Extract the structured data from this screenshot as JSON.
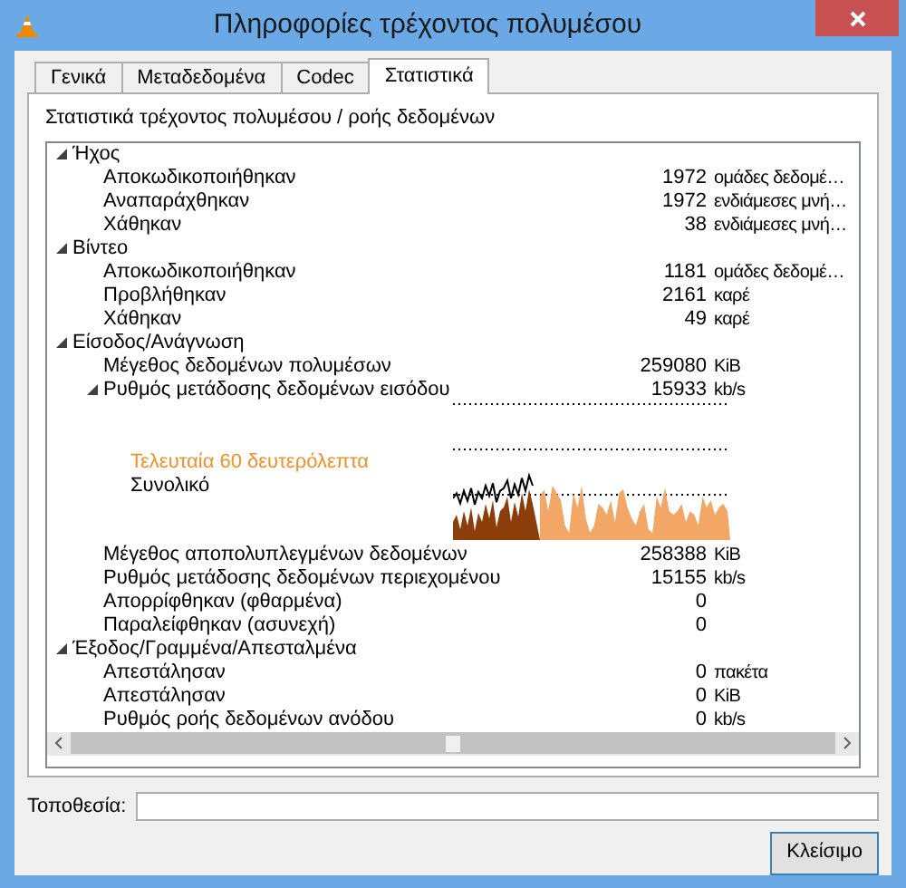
{
  "window": {
    "title": "Πληροφορίες τρέχοντος πολυμέσου"
  },
  "tabs": [
    {
      "label": "Γενικά",
      "selected": false
    },
    {
      "label": "Μεταδεδομένα",
      "selected": false
    },
    {
      "label": "Codec",
      "selected": false
    },
    {
      "label": "Στατιστικά",
      "selected": true
    }
  ],
  "panel": {
    "heading": "Στατιστικά τρέχοντος πολυμέσου / ροής δεδομένων"
  },
  "tree": [
    {
      "label": "Ήχος",
      "expanded": true,
      "children": [
        {
          "label": "Αποκωδικοποιήθηκαν",
          "value": "1972",
          "unit": "ομάδες δεδομέ…"
        },
        {
          "label": "Αναπαράχθηκαν",
          "value": "1972",
          "unit": "ενδιάμεσες μνή…"
        },
        {
          "label": "Χάθηκαν",
          "value": "38",
          "unit": "ενδιάμεσες μνή…"
        }
      ]
    },
    {
      "label": "Βίντεο",
      "expanded": true,
      "children": [
        {
          "label": "Αποκωδικοποιήθηκαν",
          "value": "1181",
          "unit": "ομάδες δεδομέ…"
        },
        {
          "label": "Προβλήθηκαν",
          "value": "2161",
          "unit": "καρέ"
        },
        {
          "label": "Χάθηκαν",
          "value": "49",
          "unit": "καρέ"
        }
      ]
    },
    {
      "label": "Είσοδος/Ανάγνωση",
      "expanded": true,
      "children": [
        {
          "label": "Μέγεθος δεδομένων πολυμέσων",
          "value": "259080",
          "unit": "KiB"
        },
        {
          "label": "Ρυθμός μετάδοσης δεδομένων εισόδου",
          "value": "15933",
          "unit": "kb/s",
          "expanded": true,
          "graph": {
            "legend_recent": "Τελευταία 60 δευτερόλεπτα",
            "legend_total": "Συνολικό"
          }
        },
        {
          "label": "Μέγεθος αποπολυπλεγμένων δεδομένων",
          "value": "258388",
          "unit": "KiB"
        },
        {
          "label": "Ρυθμός μετάδοσης δεδομένων περιεχομένου",
          "value": "15155",
          "unit": "kb/s"
        },
        {
          "label": "Απορρίφθηκαν (φθαρμένα)",
          "value": "0"
        },
        {
          "label": "Παραλείφθηκαν (ασυνεχή)",
          "value": "0"
        }
      ]
    },
    {
      "label": "Έξοδος/Γραμμένα/Απεσταλμένα",
      "expanded": true,
      "children": [
        {
          "label": "Απεστάλησαν",
          "value": "0",
          "unit": "πακέτα"
        },
        {
          "label": "Απεστάλησαν",
          "value": "0",
          "unit": "KiB"
        },
        {
          "label": "Ρυθμός ροής δεδομένων ανόδου",
          "value": "0",
          "unit": "kb/s"
        }
      ]
    }
  ],
  "location": {
    "label": "Τοποθεσία:"
  },
  "buttons": [
    "Κλείσιμο"
  ]
}
